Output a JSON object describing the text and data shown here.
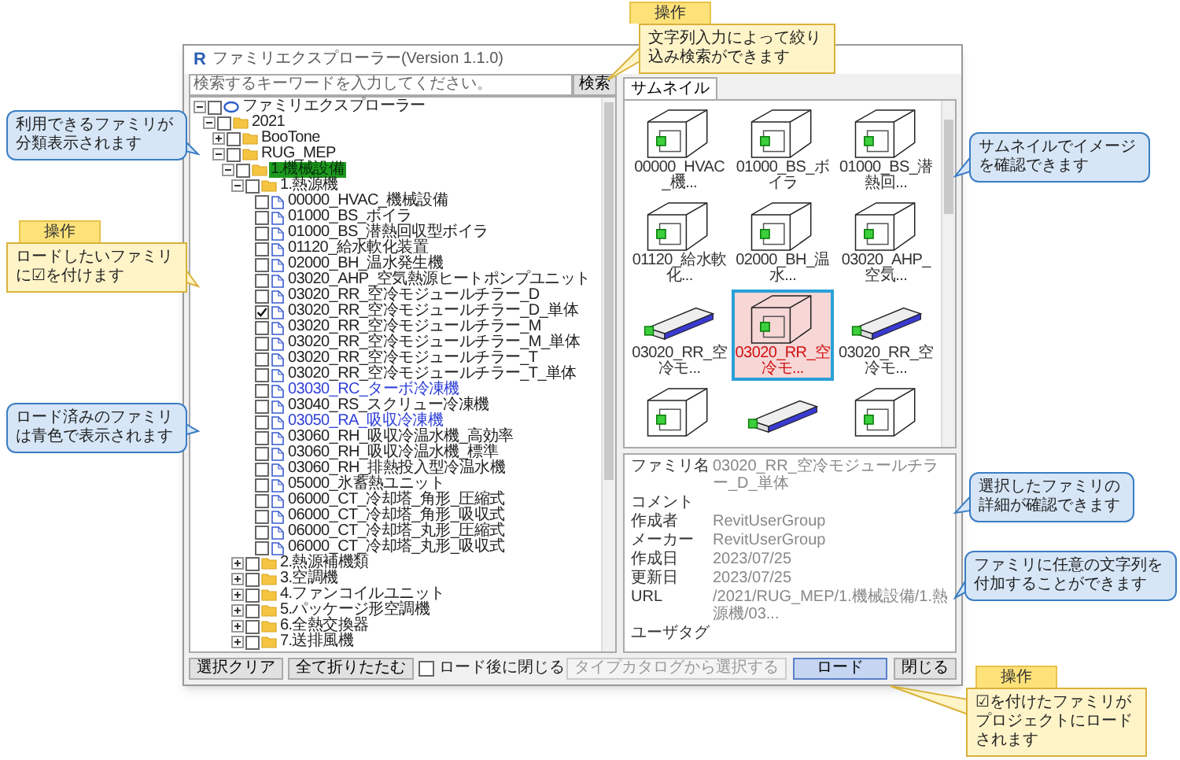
{
  "window": {
    "logo": "R",
    "title": "ファミリエクスプローラー(Version 1.1.0)"
  },
  "search": {
    "placeholder": "検索するキーワードを入力してください。",
    "button": "検索"
  },
  "tree": [
    {
      "label": "ファミリエクスプローラー",
      "kind": "root",
      "expanded": true,
      "checked": false,
      "selected": false,
      "children": [
        {
          "label": "2021",
          "kind": "folder",
          "expanded": true,
          "checked": false,
          "selected": false,
          "children": [
            {
              "label": "BooTone",
              "kind": "folder",
              "expanded": false,
              "checked": false,
              "selected": false
            },
            {
              "label": "RUG_MEP",
              "kind": "folder",
              "expanded": true,
              "checked": false,
              "selected": false,
              "children": [
                {
                  "label": "1.機械設備",
                  "kind": "folder",
                  "expanded": true,
                  "checked": false,
                  "selected": true,
                  "children": [
                    {
                      "label": "1.熱源機",
                      "kind": "folder",
                      "expanded": true,
                      "checked": false,
                      "selected": false,
                      "children": [
                        {
                          "label": "00000_HVAC_機械設備",
                          "kind": "family",
                          "checked": false,
                          "selected": false,
                          "loaded": false
                        },
                        {
                          "label": "01000_BS_ボイラ",
                          "kind": "family",
                          "checked": false,
                          "selected": false,
                          "loaded": false
                        },
                        {
                          "label": "01000_BS_潜熱回収型ボイラ",
                          "kind": "family",
                          "checked": false,
                          "selected": false,
                          "loaded": false
                        },
                        {
                          "label": "01120_給水軟化装置",
                          "kind": "family",
                          "checked": false,
                          "selected": false,
                          "loaded": false
                        },
                        {
                          "label": "02000_BH_温水発生機",
                          "kind": "family",
                          "checked": false,
                          "selected": false,
                          "loaded": false
                        },
                        {
                          "label": "03020_AHP_空気熱源ヒートポンプユニット",
                          "kind": "family",
                          "checked": false,
                          "selected": false,
                          "loaded": false
                        },
                        {
                          "label": "03020_RR_空冷モジュールチラー_D",
                          "kind": "family",
                          "checked": false,
                          "selected": false,
                          "loaded": false
                        },
                        {
                          "label": "03020_RR_空冷モジュールチラー_D_単体",
                          "kind": "family",
                          "checked": true,
                          "selected": false,
                          "loaded": false
                        },
                        {
                          "label": "03020_RR_空冷モジュールチラー_M",
                          "kind": "family",
                          "checked": false,
                          "selected": false,
                          "loaded": false
                        },
                        {
                          "label": "03020_RR_空冷モジュールチラー_M_単体",
                          "kind": "family",
                          "checked": false,
                          "selected": false,
                          "loaded": false
                        },
                        {
                          "label": "03020_RR_空冷モジュールチラー_T",
                          "kind": "family",
                          "checked": false,
                          "selected": false,
                          "loaded": false
                        },
                        {
                          "label": "03020_RR_空冷モジュールチラー_T_単体",
                          "kind": "family",
                          "checked": false,
                          "selected": false,
                          "loaded": false
                        },
                        {
                          "label": "03030_RC_ターボ冷凍機",
                          "kind": "family",
                          "checked": false,
                          "selected": false,
                          "loaded": true
                        },
                        {
                          "label": "03040_RS_スクリュー冷凍機",
                          "kind": "family",
                          "checked": false,
                          "selected": false,
                          "loaded": false
                        },
                        {
                          "label": "03050_RA_吸収冷凍機",
                          "kind": "family",
                          "checked": false,
                          "selected": false,
                          "loaded": true
                        },
                        {
                          "label": "03060_RH_吸収冷温水機_高効率",
                          "kind": "family",
                          "checked": false,
                          "selected": false,
                          "loaded": false
                        },
                        {
                          "label": "03060_RH_吸収冷温水機_標準",
                          "kind": "family",
                          "checked": false,
                          "selected": false,
                          "loaded": false
                        },
                        {
                          "label": "03060_RH_排熱投入型冷温水機",
                          "kind": "family",
                          "checked": false,
                          "selected": false,
                          "loaded": false
                        },
                        {
                          "label": "05000_氷蓄熱ユニット",
                          "kind": "family",
                          "checked": false,
                          "selected": false,
                          "loaded": false
                        },
                        {
                          "label": "06000_CT_冷却塔_角形_圧縮式",
                          "kind": "family",
                          "checked": false,
                          "selected": false,
                          "loaded": false
                        },
                        {
                          "label": "06000_CT_冷却塔_角形_吸収式",
                          "kind": "family",
                          "checked": false,
                          "selected": false,
                          "loaded": false
                        },
                        {
                          "label": "06000_CT_冷却塔_丸形_圧縮式",
                          "kind": "family",
                          "checked": false,
                          "selected": false,
                          "loaded": false
                        },
                        {
                          "label": "06000_CT_冷却塔_丸形_吸収式",
                          "kind": "family",
                          "checked": false,
                          "selected": false,
                          "loaded": false
                        }
                      ]
                    },
                    {
                      "label": "2.熱源補機類",
                      "kind": "folder",
                      "expanded": false,
                      "checked": false,
                      "selected": false
                    },
                    {
                      "label": "3.空調機",
                      "kind": "folder",
                      "expanded": false,
                      "checked": false,
                      "selected": false
                    },
                    {
                      "label": "4.ファンコイルユニット",
                      "kind": "folder",
                      "expanded": false,
                      "checked": false,
                      "selected": false
                    },
                    {
                      "label": "5.パッケージ形空調機",
                      "kind": "folder",
                      "expanded": false,
                      "checked": false,
                      "selected": false
                    },
                    {
                      "label": "6.全熱交換器",
                      "kind": "folder",
                      "expanded": false,
                      "checked": false,
                      "selected": false
                    },
                    {
                      "label": "7.送排風機",
                      "kind": "folder",
                      "expanded": false,
                      "checked": false,
                      "selected": false
                    }
                  ]
                }
              ]
            }
          ]
        }
      ]
    }
  ],
  "tabs": [
    {
      "label": "サムネイル",
      "selected": true
    }
  ],
  "thumbnails": [
    {
      "label": "00000_HVAC_機...",
      "kind": "unit",
      "selected": false
    },
    {
      "label": "01000_BS_ボイラ",
      "kind": "unit",
      "selected": false
    },
    {
      "label": "01000_BS_潜熱回...",
      "kind": "unit",
      "selected": false
    },
    {
      "label": "01120_給水軟化...",
      "kind": "unit",
      "selected": false
    },
    {
      "label": "02000_BH_温水...",
      "kind": "unit",
      "selected": false
    },
    {
      "label": "03020_AHP_空気...",
      "kind": "unit",
      "selected": false
    },
    {
      "label": "03020_RR_空冷モ...",
      "kind": "long",
      "selected": false
    },
    {
      "label": "03020_RR_空冷モ...",
      "kind": "unit",
      "selected": true
    },
    {
      "label": "03020_RR_空冷モ...",
      "kind": "long",
      "selected": false
    },
    {
      "kind": "unit",
      "selected": false
    },
    {
      "kind": "long",
      "selected": false
    },
    {
      "kind": "unit",
      "selected": false
    }
  ],
  "properties": [
    {
      "label": "ファミリ名",
      "value": "03020_RR_空冷モジュールチラー_D_単体"
    },
    {
      "label": "コメント"
    },
    {
      "label": "作成者",
      "value": "RevitUserGroup"
    },
    {
      "label": "メーカー",
      "value": "RevitUserGroup"
    },
    {
      "label": "作成日",
      "value": "2023/07/25"
    },
    {
      "label": "更新日",
      "value": "2023/07/25"
    },
    {
      "label": "URL",
      "value": "/2021/RUG_MEP/1.機械設備/1.熱源機/03..."
    },
    {
      "label": "ユーザタグ"
    }
  ],
  "bottom_bar": {
    "clear_button": "選択クリア",
    "collapse_button": "全て折りたたむ",
    "close_after_load": {
      "label": "ロード後に閉じる",
      "checked": false
    },
    "catalog_button": {
      "label": "タイプカタログから選択する",
      "disabled": true
    },
    "load_button": "ロード",
    "close_button": "閉じる"
  },
  "callouts": [
    {
      "kind": "operation",
      "tab": "操作",
      "text": "文字列入力によって絞り込み検索ができます"
    },
    {
      "kind": "info",
      "text": "利用できるファミリが分類表示されます"
    },
    {
      "kind": "operation",
      "tab": "操作",
      "text": "ロードしたいファミリに☑を付けます"
    },
    {
      "kind": "info",
      "text": "ロード済みのファミリは青色で表示されます"
    },
    {
      "kind": "info",
      "text": "サムネイルでイメージを確認できます"
    },
    {
      "kind": "info",
      "text": "選択したファミリの詳細が確認できます"
    },
    {
      "kind": "info",
      "text": "ファミリに任意の文字列を付加することができます"
    },
    {
      "kind": "operation",
      "tab": "操作",
      "text": "☑を付けたファミリがプロジェクトにロードされます"
    }
  ]
}
